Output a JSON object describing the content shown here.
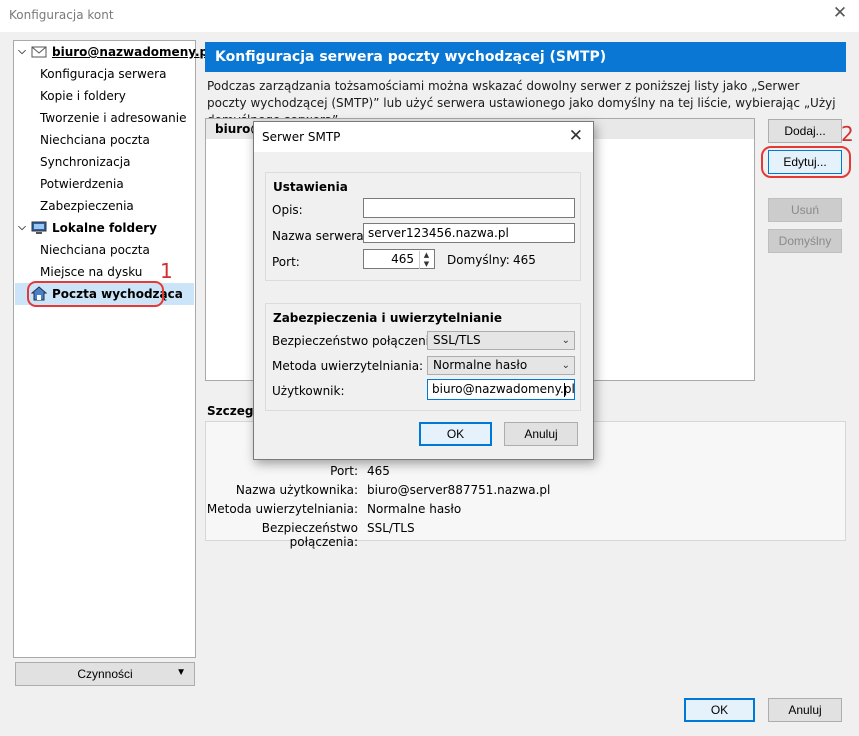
{
  "window": {
    "title": "Konfiguracja kont",
    "close_glyph": "✕"
  },
  "sidebar": {
    "account": "biuro@nazwadomeny.pl",
    "account_items": [
      "Konfiguracja serwera",
      "Kopie i foldery",
      "Tworzenie i adresowanie",
      "Niechciana poczta",
      "Synchronizacja",
      "Potwierdzenia",
      "Zabezpieczenia"
    ],
    "local": "Lokalne foldery",
    "local_items": [
      "Niechciana poczta",
      "Miejsce na dysku"
    ],
    "outgoing": "Poczta wychodząca",
    "actions_label": "Czynności",
    "icons": {
      "account": "mail-envelope-icon",
      "local": "computer-icon",
      "outgoing": "outgoing-server-icon",
      "expanded": "chevron-down-icon"
    }
  },
  "annotations": {
    "one": "1",
    "two": "2",
    "color": "#e53935"
  },
  "main": {
    "header": "Konfiguracja serwera poczty wychodzącej (SMTP)",
    "header_color": "#0a77d5",
    "description": "Podczas zarządzania tożsamościami można wskazać dowolny serwer z poniższej listy jako „Serwer poczty wychodzącej (SMTP)” lub użyć serwera ustawionego jako domyślny na tej liście, wybierając „Użyj domyślnego serwera”.",
    "list_row": "biuro@",
    "buttons": {
      "add": "Dodaj...",
      "edit": "Edytuj...",
      "remove": "Usuń",
      "default": "Domyślny"
    },
    "details_title": "Szczegó",
    "details": [
      {
        "label": "Port:",
        "value": "465"
      },
      {
        "label": "Nazwa użytkownika:",
        "value": "biuro@server887751.nazwa.pl"
      },
      {
        "label": "Metoda uwierzytelniania:",
        "value": "Normalne hasło"
      },
      {
        "label": "Bezpieczeństwo połączenia:",
        "value": "SSL/TLS"
      }
    ]
  },
  "footer": {
    "ok": "OK",
    "cancel": "Anuluj"
  },
  "dialog": {
    "title": "Serwer SMTP",
    "settings_title": "Ustawienia",
    "description_label": "Opis:",
    "description_value": "",
    "server_label": "Nazwa serwera:",
    "server_value": "server123456.nazwa.pl",
    "port_label": "Port:",
    "port_value": "465",
    "default_label": "Domyślny:",
    "default_value": "465",
    "security_title": "Zabezpieczenia i uwierzytelnianie",
    "conn_label": "Bezpieczeństwo połączenia:",
    "conn_value": "SSL/TLS",
    "auth_label": "Metoda uwierzytelniania:",
    "auth_value": "Normalne hasło",
    "user_label": "Użytkownik:",
    "user_value": "biuro@nazwadomeny.pl",
    "ok": "OK",
    "cancel": "Anuluj"
  }
}
